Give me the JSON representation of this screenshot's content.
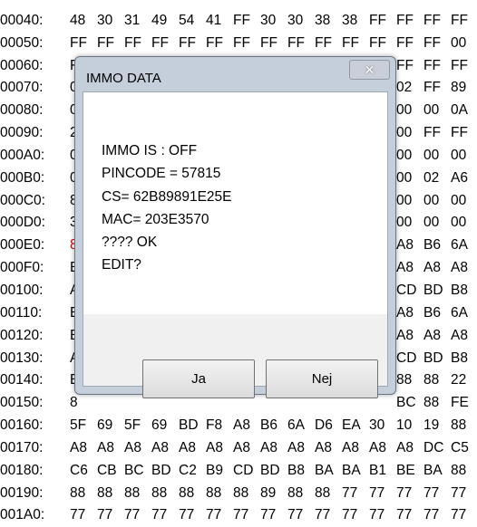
{
  "hex_rows": [
    {
      "addr": "00040:",
      "bytes": [
        "48",
        "30",
        "31",
        "49",
        "54",
        "41",
        "FF",
        "30",
        "30",
        "38",
        "38",
        "FF",
        "FF",
        "FF",
        "FF"
      ]
    },
    {
      "addr": "00050:",
      "bytes": [
        "FF",
        "FF",
        "FF",
        "FF",
        "FF",
        "FF",
        "FF",
        "FF",
        "FF",
        "FF",
        "FF",
        "FF",
        "FF",
        "FF",
        "00"
      ]
    },
    {
      "addr": "00060:",
      "bytes": [
        "F",
        "",
        "",
        "",
        "",
        "",
        "",
        "",
        "",
        "",
        "",
        "",
        "FF",
        "FF",
        "FF"
      ]
    },
    {
      "addr": "00070:",
      "bytes": [
        "0",
        "",
        "",
        "",
        "",
        "",
        "",
        "",
        "",
        "",
        "",
        "",
        "02",
        "FF",
        "89"
      ]
    },
    {
      "addr": "00080:",
      "bytes": [
        "0",
        "",
        "",
        "",
        "",
        "",
        "",
        "",
        "",
        "",
        "",
        "",
        "00",
        "00",
        "0A"
      ]
    },
    {
      "addr": "00090:",
      "bytes": [
        "2",
        "",
        "",
        "",
        "",
        "",
        "",
        "",
        "",
        "",
        "",
        "",
        "00",
        "FF",
        "FF"
      ]
    },
    {
      "addr": "000A0:",
      "bytes": [
        "0",
        "",
        "",
        "",
        "",
        "",
        "",
        "",
        "",
        "",
        "",
        "",
        "00",
        "00",
        "00"
      ]
    },
    {
      "addr": "000B0:",
      "bytes": [
        "0",
        "",
        "",
        "",
        "",
        "",
        "",
        "",
        "",
        "",
        "",
        "",
        "00",
        "02",
        "A6"
      ]
    },
    {
      "addr": "000C0:",
      "bytes": [
        "8",
        "",
        "",
        "",
        "",
        "",
        "",
        "",
        "",
        "",
        "",
        "",
        "00",
        "00",
        "00"
      ]
    },
    {
      "addr": "000D0:",
      "bytes": [
        "3",
        "",
        "",
        "",
        "",
        "",
        "",
        "",
        "",
        "",
        "",
        "",
        "00",
        "00",
        "00"
      ]
    },
    {
      "addr": "000E0:",
      "bytes": [
        "8",
        "",
        "",
        "",
        "",
        "",
        "",
        "",
        "",
        "",
        "",
        "",
        "A8",
        "B6",
        "6A"
      ]
    },
    {
      "addr": "000F0:",
      "bytes": [
        "E",
        "",
        "",
        "",
        "",
        "",
        "",
        "",
        "",
        "",
        "",
        "",
        "A8",
        "A8",
        "A8"
      ]
    },
    {
      "addr": "00100:",
      "bytes": [
        "A",
        "",
        "",
        "",
        "",
        "",
        "",
        "",
        "",
        "",
        "",
        "",
        "CD",
        "BD",
        "B8"
      ]
    },
    {
      "addr": "00110:",
      "bytes": [
        "E",
        "",
        "",
        "",
        "",
        "",
        "",
        "",
        "",
        "",
        "",
        "",
        "A8",
        "B6",
        "6A"
      ]
    },
    {
      "addr": "00120:",
      "bytes": [
        "E",
        "",
        "",
        "",
        "",
        "",
        "",
        "",
        "",
        "",
        "",
        "",
        "A8",
        "A8",
        "A8"
      ]
    },
    {
      "addr": "00130:",
      "bytes": [
        "A",
        "",
        "",
        "",
        "",
        "",
        "",
        "",
        "",
        "",
        "",
        "",
        "CD",
        "BD",
        "B8"
      ]
    },
    {
      "addr": "00140:",
      "bytes": [
        "E",
        "",
        "",
        "",
        "",
        "",
        "",
        "",
        "",
        "",
        "",
        "",
        "88",
        "88",
        "22"
      ]
    },
    {
      "addr": "00150:",
      "bytes": [
        "8",
        "",
        "",
        "",
        "",
        "",
        "",
        "",
        "",
        "",
        "",
        "",
        "BC",
        "88",
        "FE"
      ]
    },
    {
      "addr": "00160:",
      "bytes": [
        "5F",
        "69",
        "5F",
        "69",
        "BD",
        "F8",
        "A8",
        "B6",
        "6A",
        "D6",
        "EA",
        "30",
        "10",
        "19",
        "88"
      ]
    },
    {
      "addr": "00170:",
      "bytes": [
        "A8",
        "A8",
        "A8",
        "A8",
        "A8",
        "A8",
        "A8",
        "A8",
        "A8",
        "A8",
        "A8",
        "A8",
        "A8",
        "DC",
        "C5"
      ]
    },
    {
      "addr": "00180:",
      "bytes": [
        "C6",
        "CB",
        "BC",
        "BD",
        "C2",
        "B9",
        "CD",
        "BD",
        "B8",
        "BA",
        "BA",
        "B1",
        "BE",
        "BA",
        "88"
      ]
    },
    {
      "addr": "00190:",
      "bytes": [
        "88",
        "88",
        "88",
        "88",
        "88",
        "88",
        "88",
        "89",
        "88",
        "88",
        "77",
        "77",
        "77",
        "77",
        "77"
      ]
    },
    {
      "addr": "001A0:",
      "bytes": [
        "77",
        "77",
        "77",
        "77",
        "77",
        "77",
        "77",
        "77",
        "77",
        "77",
        "77",
        "77",
        "77",
        "77",
        "77"
      ]
    }
  ],
  "highlight_color": "#cc0000",
  "dialog": {
    "title": "IMMO DATA",
    "close_glyph": "✕",
    "lines": [
      "IMMO IS : OFF",
      "PINCODE = 57815",
      "CS= 62B89891E25E",
      "MAC= 203E3570",
      "???? OK",
      "EDIT?"
    ],
    "yes_label": "Ja",
    "no_label": "Nej"
  }
}
